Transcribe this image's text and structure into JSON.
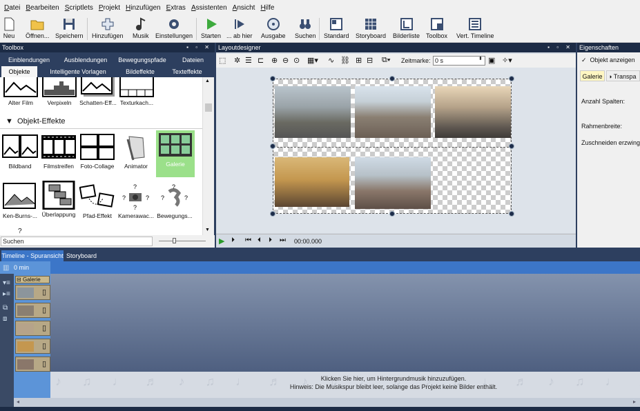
{
  "menu": [
    "Datei",
    "Bearbeiten",
    "Scriptlets",
    "Projekt",
    "Hinzufügen",
    "Extras",
    "Assistenten",
    "Ansicht",
    "Hilfe"
  ],
  "toolbar": {
    "neu": "Neu",
    "oeffnen": "Öffnen...",
    "speichern": "Speichern",
    "hinzufuegen": "Hinzufügen",
    "musik": "Musik",
    "einstellungen": "Einstellungen",
    "starten": "Starten",
    "abhier": "... ab hier",
    "ausgabe": "Ausgabe",
    "suchen": "Suchen",
    "standard": "Standard",
    "storyboard": "Storyboard",
    "bilderliste": "Bilderliste",
    "toolbox": "Toolbox",
    "verttimeline": "Vert. Timeline"
  },
  "toolbox": {
    "title": "Toolbox",
    "tabs_row1": [
      "Einblendungen",
      "Ausblendungen",
      "Bewegungspfade",
      "Dateien"
    ],
    "tabs_row2": [
      "Objekte",
      "Intelligente Vorlagen",
      "Bildeffekte",
      "Texteffekte"
    ],
    "top_tiles": [
      "Alter Film",
      "Verpixeln",
      "Schatten-Eff...",
      "Texturkach..."
    ],
    "section": "Objekt-Effekte",
    "tiles_row1": [
      "Bildband",
      "Filmstreifen",
      "Foto-Collage",
      "Animator",
      "Galerie"
    ],
    "tiles_row2": [
      "Ken-Burns-...",
      "Überlappung",
      "Pfad-Effekt",
      "Kamerawac...",
      "Bewegungs..."
    ],
    "search_text": "Suchen"
  },
  "layout": {
    "title": "Layoutdesigner",
    "zeitmarke_label": "Zeitmarke:",
    "zeitmarke_value": "0 s",
    "timecode": "00:00.000"
  },
  "props": {
    "title": "Eigenschaften",
    "show_object": "Objekt anzeigen",
    "tabs": [
      "Galerie",
      "Transpa"
    ],
    "anzahl_spalten": "Anzahl Spalten:",
    "rahmenbreite": "Rahmenbreite:",
    "zuschneiden": "Zuschneiden erzwingen"
  },
  "timeline": {
    "tabs": [
      "Timeline - Spuransicht",
      "Storyboard"
    ],
    "ruler_label": "0 min",
    "group_label": "Galerie",
    "music_hint_1": "Klicken Sie hier, um Hintergrundmusik hinzuzufügen.",
    "music_hint_2": "Hinweis: Die Musikspur bleibt leer, solange das Projekt keine Bilder enthält."
  },
  "colors": {
    "accent": "#3c76c8",
    "panel": "#2d3f5f",
    "selected_tile": "#9be08a"
  }
}
